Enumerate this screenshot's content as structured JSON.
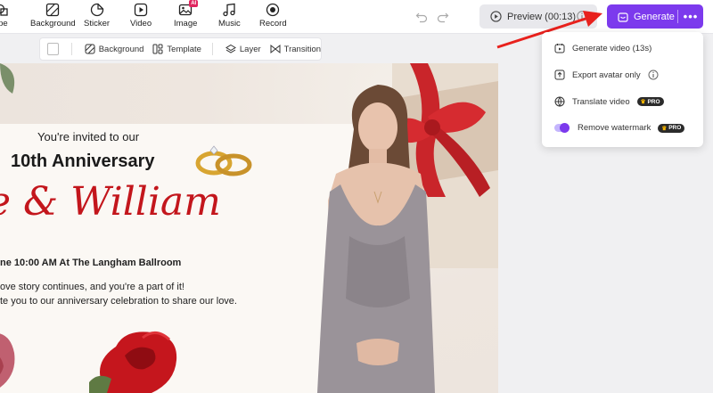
{
  "toolbar": {
    "tools": [
      {
        "label": "Shape",
        "icon": "shape-icon"
      },
      {
        "label": "Background",
        "icon": "background-icon"
      },
      {
        "label": "Sticker",
        "icon": "sticker-icon"
      },
      {
        "label": "Video",
        "icon": "video-icon"
      },
      {
        "label": "Image",
        "icon": "image-icon",
        "badge": "AI"
      },
      {
        "label": "Music",
        "icon": "music-icon"
      },
      {
        "label": "Record",
        "icon": "record-icon"
      }
    ],
    "preview_label": "Preview (00:13)",
    "generate_label": "Generate",
    "more_label": "•••"
  },
  "subtoolbar": {
    "background_label": "Background",
    "template_label": "Template",
    "layer_label": "Layer",
    "transition_label": "Transition"
  },
  "dropdown": {
    "generate_video": "Generate video (13s)",
    "export_avatar": "Export avatar only",
    "translate_video": "Translate video",
    "remove_watermark": "Remove watermark",
    "pro_badge": "PRO"
  },
  "canvas": {
    "invited": "You're invited to our",
    "anniversary": "10th Anniversary",
    "names": "e & William",
    "details": "ne 10:00 AM   At The Langham Ballroom",
    "message_line1": "ove story continues, and you're a part of it!",
    "message_line2": "te you to our anniversary celebration to share our love."
  },
  "colors": {
    "accent": "#7c3aed",
    "title_red": "#c3161c"
  }
}
